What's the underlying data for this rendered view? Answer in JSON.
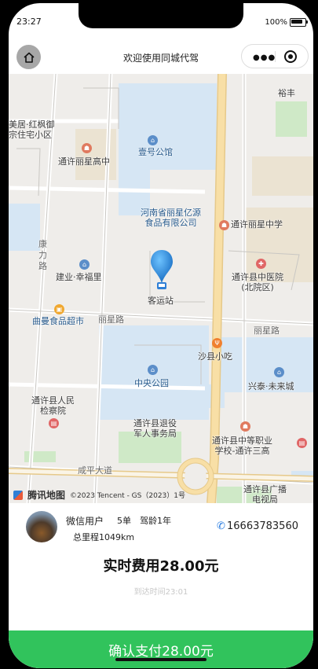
{
  "status_bar": {
    "time": "23:27",
    "battery": "100%"
  },
  "nav": {
    "title": "欢迎使用同城代驾",
    "home_icon": "home-icon",
    "more_icon": "more-icon",
    "close_icon": "close-circle-icon"
  },
  "map": {
    "pois": [
      {
        "name": "lbl-yuxin",
        "text": "裕丰",
        "cls": ""
      },
      {
        "name": "lbl-hongfeng",
        "text": "美居·红枫御\n宗住宅小区",
        "cls": ""
      },
      {
        "name": "lbl-gaozhong",
        "text": "通许丽星高中",
        "cls": ""
      },
      {
        "name": "lbl-gongguan",
        "text": "壹号公馆",
        "cls": "blue"
      },
      {
        "name": "lbl-food-co",
        "text": "河南省丽星亿源\n食品有限公司",
        "cls": "blue"
      },
      {
        "name": "lbl-middle",
        "text": "通许丽星中学",
        "cls": ""
      },
      {
        "name": "lbl-kangli",
        "text": "康\n力\n路",
        "cls": "road"
      },
      {
        "name": "lbl-jianye",
        "text": "建业·幸福里",
        "cls": ""
      },
      {
        "name": "lbl-zhongyi",
        "text": "通许县中医院\n(北院区)",
        "cls": ""
      },
      {
        "name": "lbl-bus",
        "text": "客运站",
        "cls": ""
      },
      {
        "name": "lbl-qumanm",
        "text": "曲曼食品超市",
        "cls": "blue"
      },
      {
        "name": "lbl-lixing-road-1",
        "text": "丽星路",
        "cls": "road"
      },
      {
        "name": "lbl-lixing-road-2",
        "text": "丽星路",
        "cls": "road"
      },
      {
        "name": "lbl-snack",
        "text": "沙县小吃",
        "cls": ""
      },
      {
        "name": "lbl-park",
        "text": "中央公园",
        "cls": "blue"
      },
      {
        "name": "lbl-xingtai",
        "text": "兴泰·未来城",
        "cls": ""
      },
      {
        "name": "lbl-procur",
        "text": "通许县人民\n检察院",
        "cls": ""
      },
      {
        "name": "lbl-veteran",
        "text": "通许县退役\n军人事务局",
        "cls": ""
      },
      {
        "name": "lbl-vocational",
        "text": "通许县中等职业\n学校-通许三高",
        "cls": ""
      },
      {
        "name": "lbl-xianping",
        "text": "咸平大道",
        "cls": "road"
      },
      {
        "name": "lbl-broadcast",
        "text": "通许县广播\n电视局",
        "cls": ""
      }
    ],
    "footer": {
      "logo": "腾讯地图",
      "copyright": "©2023 Tencent - GS（2023）1号"
    }
  },
  "driver": {
    "name": "微信用户",
    "orders": "5单",
    "driving_age": "驾龄1年",
    "mileage": "总里程1049km",
    "phone": "16663783560"
  },
  "fare": {
    "label": "实时费用28.00元",
    "arrive": "到达时间23:01"
  },
  "pay_button": "确认支付28.00元",
  "colors": {
    "accent": "#31c35c",
    "phone": "#2a7de1",
    "water": "#d6e6f4",
    "park": "#cfe9c7",
    "main_road": "#f8dfa6"
  }
}
